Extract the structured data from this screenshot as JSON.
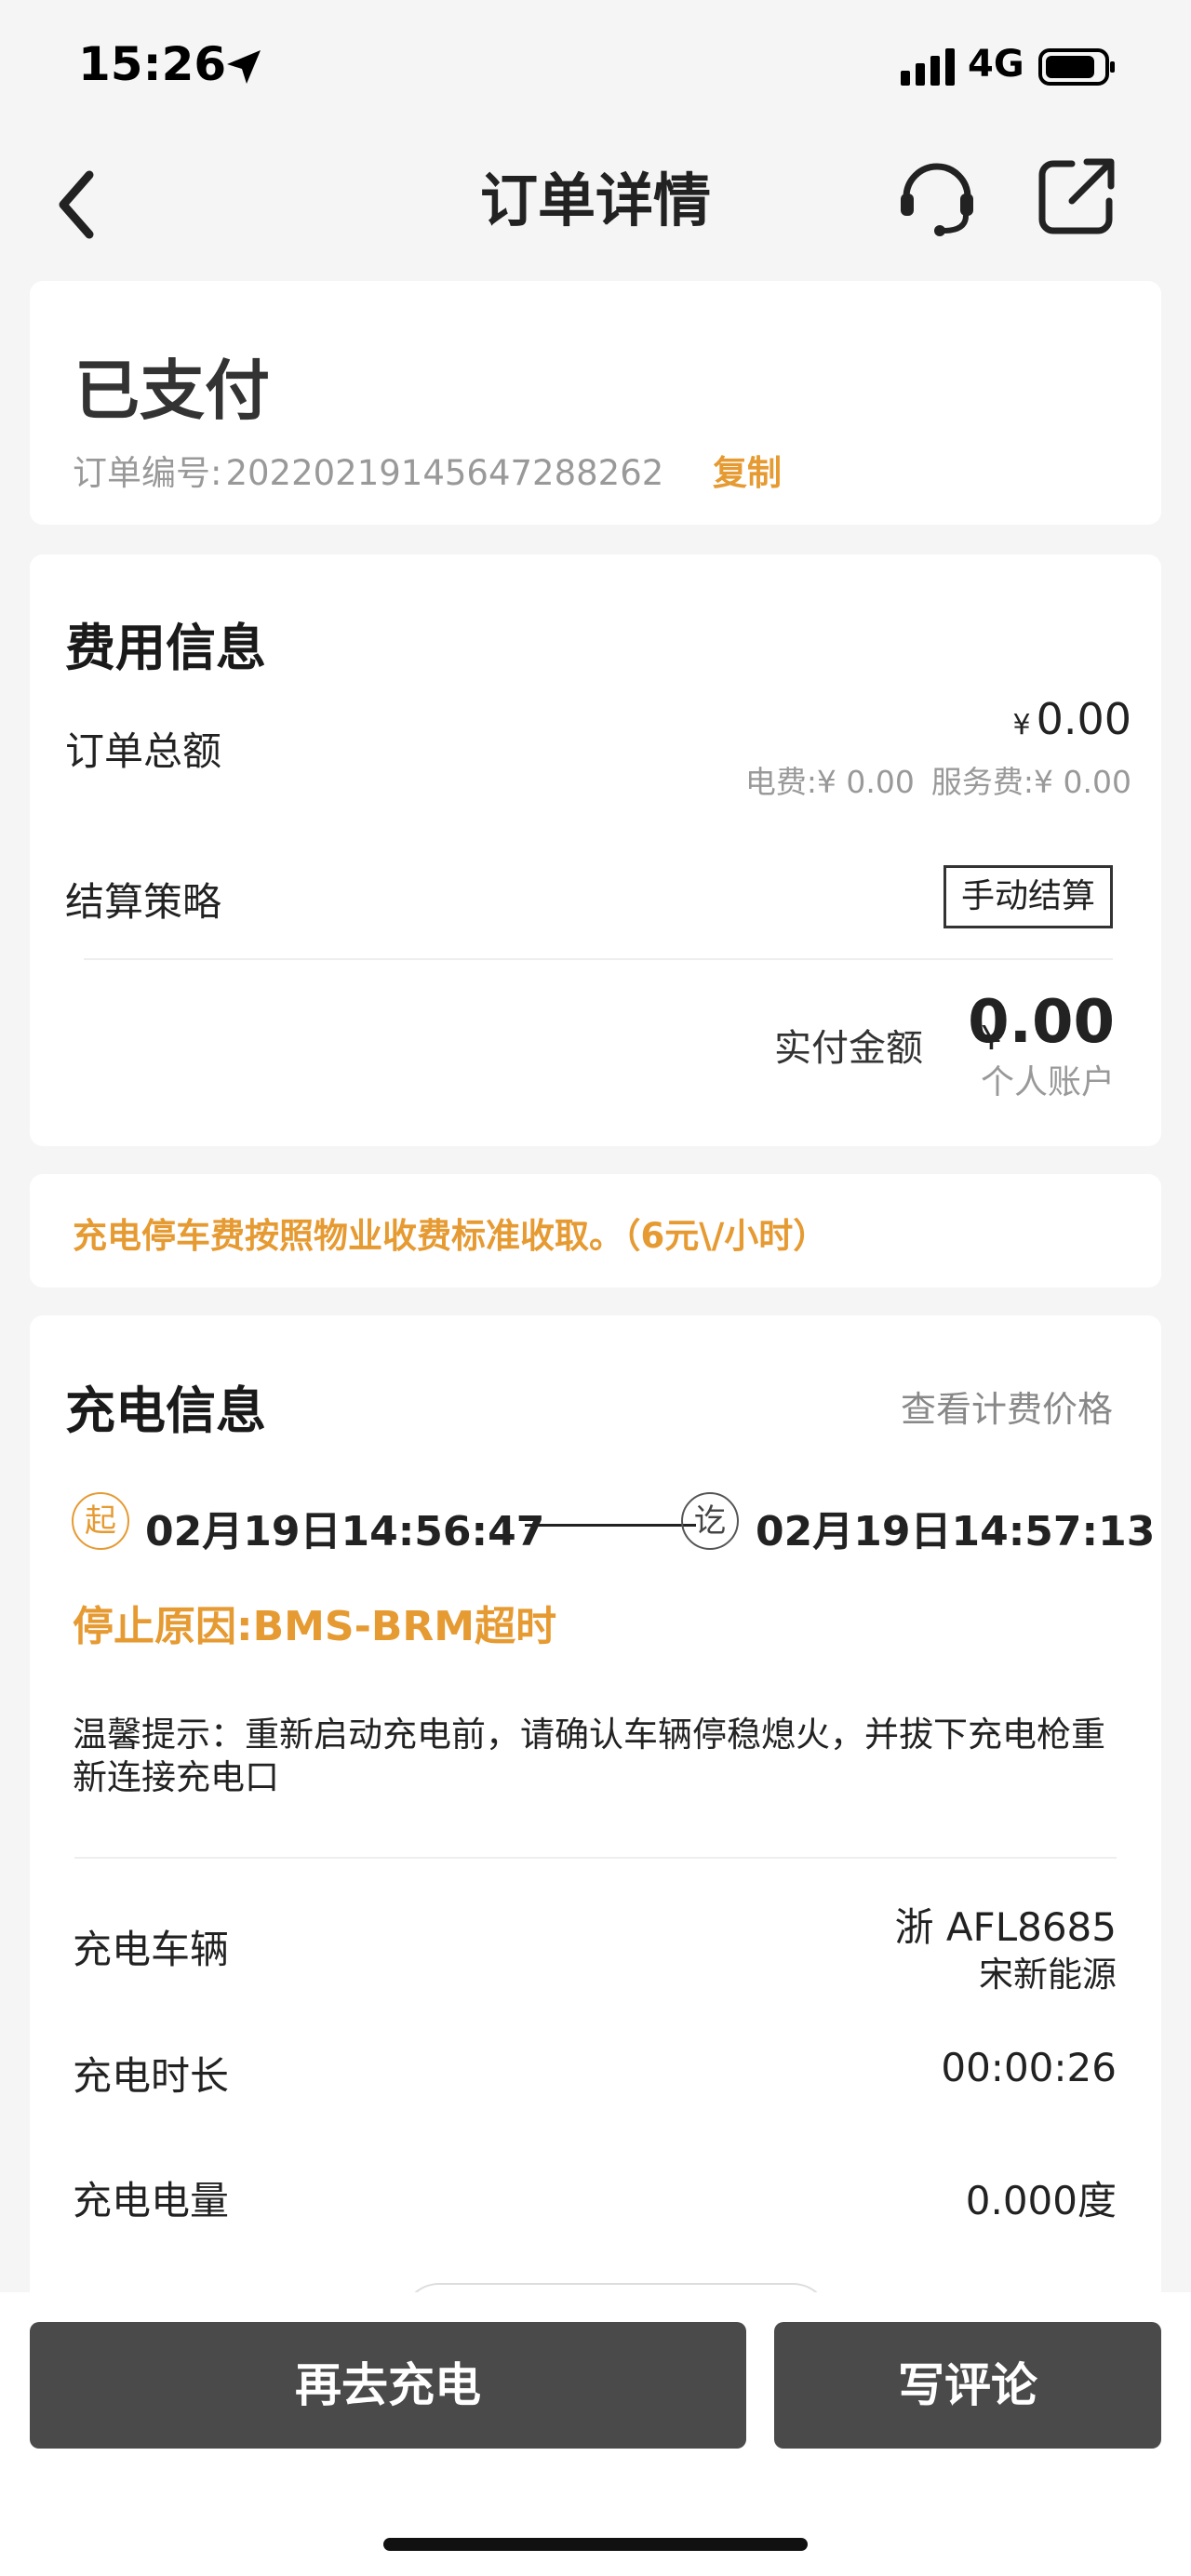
{
  "status_bar": {
    "time": "15:26",
    "network": "4G",
    "icons": [
      "location-arrow-icon",
      "signal-icon",
      "battery-icon"
    ]
  },
  "nav": {
    "title": "订单详情",
    "icons": [
      "back-icon",
      "headset-icon",
      "share-icon"
    ]
  },
  "order": {
    "status": "已支付",
    "number_label": "订单编号:",
    "number": "20220219145647288262",
    "copy_label": "复制"
  },
  "fee": {
    "title": "费用信息",
    "total_label": "订单总额",
    "total_currency": "¥",
    "total_amount": "0.00",
    "electricity_fee": "电费:¥ 0.00",
    "service_fee": "服务费:¥ 0.00",
    "strategy_label": "结算策略",
    "strategy_value": "手动结算",
    "paid_label": "实付金额",
    "paid_currency": "¥",
    "paid_amount": "0.00",
    "paid_account": "个人账户"
  },
  "notice": {
    "text": "充电停车费按照物业收费标准收取。（6元\\/小时）"
  },
  "charge": {
    "title": "充电信息",
    "price_link": "查看计费价格",
    "start_badge": "起",
    "start_time": "02月19日14:56:47",
    "end_badge": "讫",
    "end_time": "02月19日14:57:13",
    "stop_reason": "停止原因:BMS-BRM超时",
    "tip": "温馨提示：重新启动充电前，请确认车辆停稳熄火，并拔下充电枪重新连接充电口",
    "vehicle_label": "充电车辆",
    "vehicle_plate": "浙 AFL8685",
    "vehicle_brand": "宋新能源",
    "duration_label": "充电时长",
    "duration_value": "00:00:26",
    "energy_label": "充电电量",
    "energy_value": "0.000度"
  },
  "actions": {
    "recharge_label": "再去充电",
    "review_label": "写评论"
  },
  "colors": {
    "accent": "#e69a32",
    "button": "#4a4a4a",
    "background": "#f5f5f5"
  }
}
